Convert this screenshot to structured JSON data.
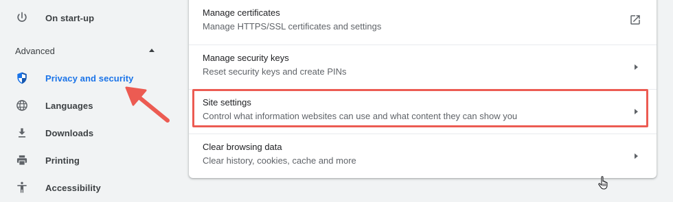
{
  "sidebar": {
    "items": [
      {
        "label": "On start-up",
        "icon": "power-icon"
      },
      {
        "label": "Privacy and security",
        "icon": "shield-icon",
        "active": true
      },
      {
        "label": "Languages",
        "icon": "globe-icon"
      },
      {
        "label": "Downloads",
        "icon": "download-icon"
      },
      {
        "label": "Printing",
        "icon": "printer-icon"
      },
      {
        "label": "Accessibility",
        "icon": "accessibility-icon"
      }
    ],
    "advanced_label": "Advanced"
  },
  "settings_card": {
    "rows": [
      {
        "title": "Manage certificates",
        "description": "Manage HTTPS/SSL certificates and settings",
        "action_icon": "open-in-new-icon"
      },
      {
        "title": "Manage security keys",
        "description": "Reset security keys and create PINs",
        "action_icon": "arrow-right-icon"
      },
      {
        "title": "Site settings",
        "description": "Control what information websites can use and what content they can show you",
        "action_icon": "arrow-right-icon",
        "highlighted": true
      },
      {
        "title": "Clear browsing data",
        "description": "Clear history, cookies, cache and more",
        "action_icon": "arrow-right-icon"
      }
    ]
  },
  "colors": {
    "background": "#f1f3f4",
    "card": "#ffffff",
    "accent_blue": "#1a73e8",
    "annotation_red": "#ec5b52",
    "text_primary": "#202124",
    "text_secondary": "#5f6368"
  }
}
